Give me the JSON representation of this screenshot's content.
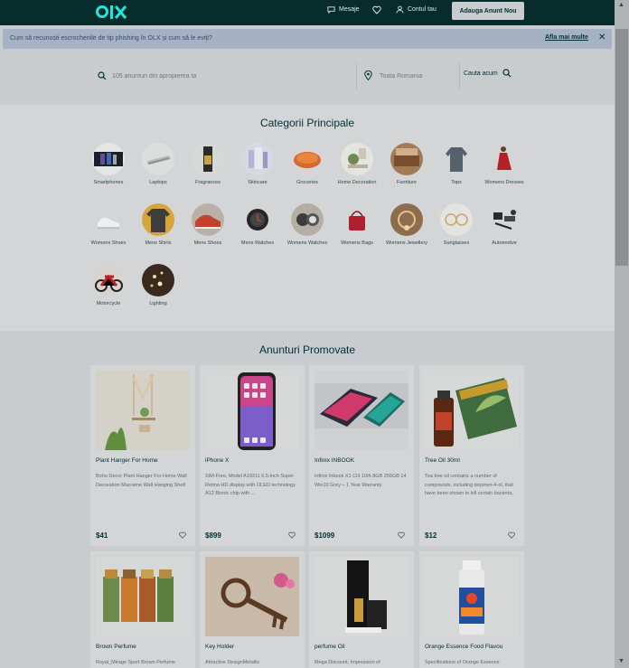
{
  "header": {
    "logo": "OLX",
    "messages_label": "Mesaje",
    "account_label": "Contul tau",
    "post_button": "Adauga Anunt Nou"
  },
  "banner": {
    "text": "Cum să recunoști escrocheriile de tip phishing în OLX și cum să le eviți?",
    "link": "Afla mai multe"
  },
  "search": {
    "placeholder": "105 anunturi din apropierea ta",
    "location_placeholder": "Toata Romania",
    "button_label": "Cauta acum"
  },
  "categories": {
    "title": "Categorii Principale",
    "items": [
      {
        "label": "Smartphones"
      },
      {
        "label": "Laptops"
      },
      {
        "label": "Fragrances"
      },
      {
        "label": "Skincare"
      },
      {
        "label": "Groceries"
      },
      {
        "label": "Home Decoration"
      },
      {
        "label": "Furniture"
      },
      {
        "label": "Tops"
      },
      {
        "label": "Womens Dresses"
      },
      {
        "label": "Womens Shoes"
      },
      {
        "label": "Mens Shirts"
      },
      {
        "label": "Mens Shoes"
      },
      {
        "label": "Mens Watches"
      },
      {
        "label": "Womens Watches"
      },
      {
        "label": "Womens Bags"
      },
      {
        "label": "Womens Jewellery"
      },
      {
        "label": "Sunglasses"
      },
      {
        "label": "Automotive"
      },
      {
        "label": "Motorcycle"
      },
      {
        "label": "Lighting"
      }
    ]
  },
  "promoted": {
    "title": "Anunturi Promovate",
    "items": [
      {
        "title": "Plant Hanger For Home",
        "description": "Boho Decor Plant Hanger For Home Wall Decoration Macrame Wall Hanging Shelf",
        "price": "$41"
      },
      {
        "title": "iPhone X",
        "description": "SIM-Free, Model A19211 6.5-inch Super Retina HD display with OLED technology A12 Bionic chip with ...",
        "price": "$899"
      },
      {
        "title": "Infinix INBOOK",
        "description": "Infinix Inbook X1 Ci3 10th 8GB 256GB 14 Win10 Grey – 1 Year Warranty",
        "price": "$1099"
      },
      {
        "title": "Tree Oil 30ml",
        "description": "Tea tree oil contains a number of compounds, including terpinen-4-ol, that have been shown to kill certain bacteria,",
        "price": "$12"
      },
      {
        "title": "Brown Perfume",
        "description": "Royal_Mirage Sport Brown Perfume",
        "price": ""
      },
      {
        "title": "Key Holder",
        "description": "Attractive DesignMetallic",
        "price": ""
      },
      {
        "title": "perfume Oil",
        "description": "Mega Discount, Impression of",
        "price": ""
      },
      {
        "title": "Orange Essence Food Flavou",
        "description": "Specifications of Orange Essence",
        "price": ""
      }
    ]
  },
  "colors": {
    "header_bg": "#082c2c",
    "logo_teal": "#23e5db",
    "banner_bg": "#a5b2c6",
    "page_bg": "#c9ccce"
  }
}
